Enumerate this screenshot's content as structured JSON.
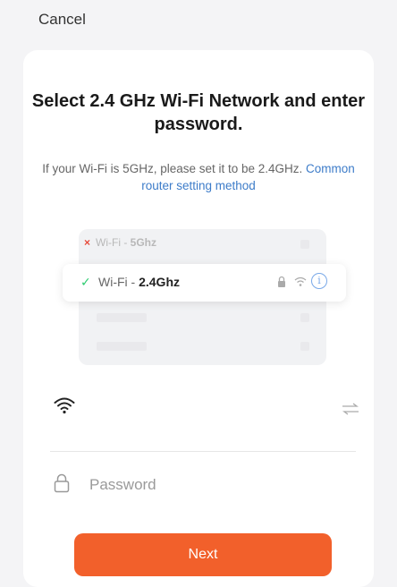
{
  "header": {
    "cancel_label": "Cancel"
  },
  "title": "Select 2.4 GHz Wi-Fi Network and enter password.",
  "subtitle": {
    "text": "If your Wi-Fi is 5GHz, please set it to be 2.4GHz.",
    "link": "Common router setting method"
  },
  "illustration": {
    "row_5ghz": {
      "mark": "×",
      "prefix": "Wi-Fi - ",
      "band": "5Ghz"
    },
    "row_24ghz": {
      "mark": "✓",
      "prefix": "Wi-Fi - ",
      "band": "2.4Ghz",
      "info_glyph": "i"
    }
  },
  "wifi_field": {
    "value": "",
    "icon": "wifi-icon",
    "switch_icon": "switch-network-icon"
  },
  "password_field": {
    "placeholder": "Password",
    "value": "",
    "icon": "lock-icon"
  },
  "next_button": {
    "label": "Next"
  },
  "colors": {
    "accent": "#f2602b",
    "link": "#3d7cc9",
    "check": "#2ecc71",
    "cross": "#e74c3c"
  }
}
